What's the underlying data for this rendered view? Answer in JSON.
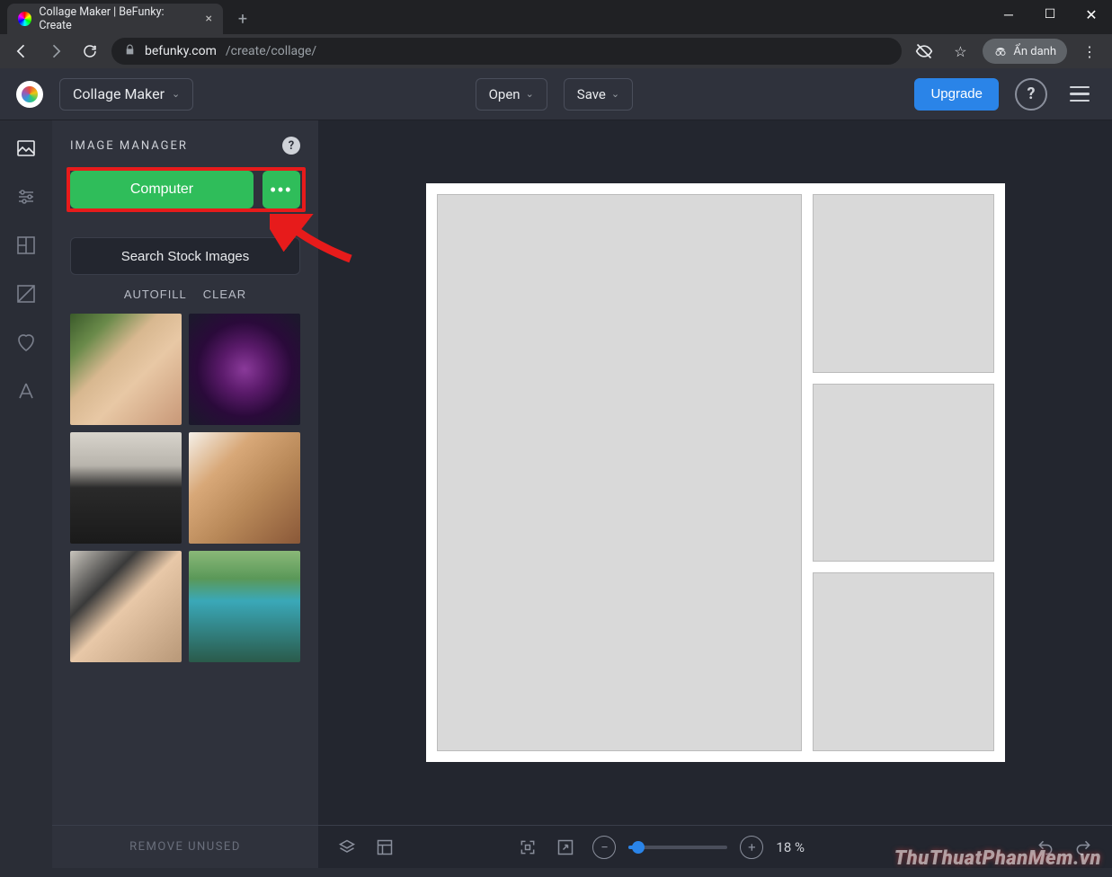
{
  "window": {
    "tab_title": "Collage Maker | BeFunky: Create"
  },
  "browser": {
    "url_host": "befunky.com",
    "url_path": "/create/collage/",
    "incognito_label": "Ẩn danh"
  },
  "header": {
    "mode_label": "Collage Maker",
    "open_label": "Open",
    "save_label": "Save",
    "upgrade_label": "Upgrade"
  },
  "panel": {
    "title": "IMAGE MANAGER",
    "computer_label": "Computer",
    "more_label": "•••",
    "stock_label": "Search Stock Images",
    "autofill_label": "AUTOFILL",
    "clear_label": "CLEAR",
    "remove_unused_label": "REMOVE UNUSED"
  },
  "bottom": {
    "zoom_value": "18 %"
  },
  "watermark": "ThuThuatPhanMem.vn"
}
